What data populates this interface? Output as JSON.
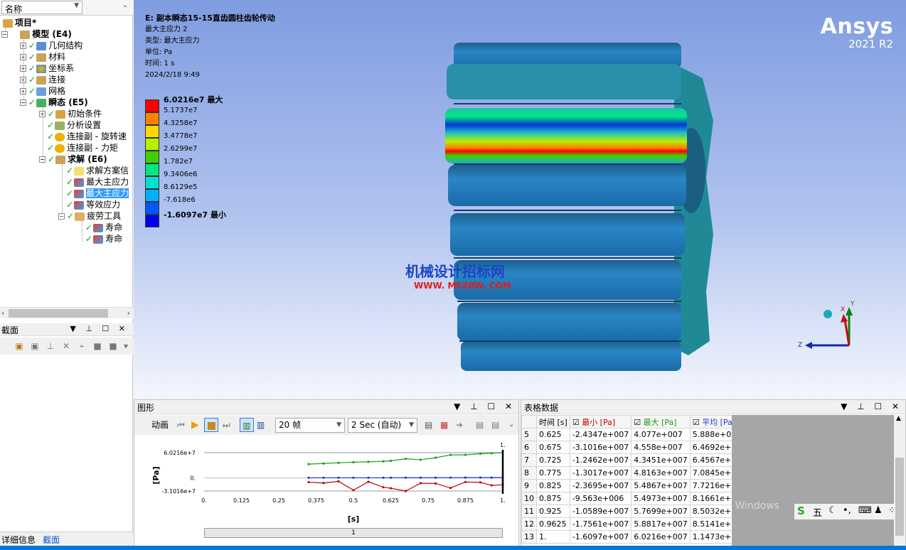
{
  "tree": {
    "header_select": "名称",
    "project": "项目*",
    "model": "模型 (E4)",
    "geometry": "几何结构",
    "materials": "材料",
    "coords": "坐标系",
    "connections": "连接",
    "mesh": "网格",
    "transient": "瞬态 (E5)",
    "initial": "初始条件",
    "analysis": "分析设置",
    "joint_rot": "连接副 - 旋转速",
    "joint_torque": "连接副 - 力矩",
    "solution": "求解 (E6)",
    "sol_info": "求解方案信",
    "max_p1": "最大主应力",
    "max_p2": "最大主应力",
    "eqv": "等效应力",
    "fatigue": "疲劳工具",
    "life1": "寿命",
    "life2": "寿命"
  },
  "section_panel": {
    "title": "截面"
  },
  "bottom_tabs": {
    "details": "详细信息",
    "section": "截面"
  },
  "viewport": {
    "title": "E: 副本瞬态15-15直齿圆柱齿轮传动",
    "result": "最大主应力 2",
    "type": "类型: 最大主应力",
    "unit": "单位: Pa",
    "time": "时间: 1 s",
    "date": "2024/2/18 9:49",
    "brand": "Ansys",
    "version": "2021 R2",
    "watermark_cn": "机械设计招标网",
    "watermark_url": "WWW. MEZBW. COM",
    "axis_x": "X",
    "axis_y": "Y",
    "axis_z": "Z"
  },
  "legend": {
    "labels": [
      "6.0216e7 最大",
      "5.1737e7",
      "4.3258e7",
      "3.4778e7",
      "2.6299e7",
      "1.782e7",
      "9.3406e6",
      "8.6129e5",
      "-7.618e6",
      "-1.6097e7 最小"
    ],
    "colors": [
      "#ff0000",
      "#ff7f00",
      "#ffd800",
      "#b6f000",
      "#3ed000",
      "#00e87e",
      "#00e2d0",
      "#00b0ff",
      "#0058ff",
      "#0000f0"
    ]
  },
  "graph_panel": {
    "title": "图形",
    "animate": "动画",
    "frames": "20 帧",
    "duration": "2 Sec (自动)",
    "time_slider_label": "1"
  },
  "chart_data": {
    "type": "line",
    "xlabel": "[s]",
    "ylabel": "[Pa]",
    "xlim": [
      0,
      1
    ],
    "ylim": [
      -31016000.0,
      60216000.0
    ],
    "x_ticks": [
      "0.",
      "0.125",
      "0.25",
      "0.375",
      "0.5",
      "0.625",
      "0.75",
      "0.875",
      "1."
    ],
    "y_ticks": [
      "6.0216e+7",
      "0.",
      "-3.1016e+7"
    ],
    "top_right_label": "1.",
    "x": [
      0.35,
      0.4,
      0.45,
      0.5,
      0.55,
      0.6,
      0.625,
      0.675,
      0.725,
      0.775,
      0.825,
      0.875,
      0.925,
      0.9625,
      1.0
    ],
    "series": [
      {
        "name": "最小 [Pa]",
        "color": "#c00000",
        "values": [
          -10000000.0,
          -12000000.0,
          -8000000.0,
          -29000000.0,
          -9000000.0,
          -22000000.0,
          -24347000.0,
          -31016000.0,
          -12462000.0,
          -13017000.0,
          -23695000.0,
          -9563000.0,
          -10589000.0,
          -17561000.0,
          -16097000.0
        ]
      },
      {
        "name": "最大 [Pa]",
        "color": "#1a9e1a",
        "values": [
          33000000.0,
          34500000.0,
          36000000.0,
          37500000.0,
          38500000.0,
          39500000.0,
          40770000.0,
          45580000.0,
          43451000.0,
          48163000.0,
          54867000.0,
          54973000.0,
          57699000.0,
          58817000.0,
          60216000.0
        ]
      },
      {
        "name": "平均 [Pa]",
        "color": "#1e3cc8",
        "values": [
          550000.0,
          560000.0,
          570000.0,
          575000.0,
          580000.0,
          585000.0,
          588800.0,
          646920.0,
          645670.0,
          708450.0,
          772160.0,
          816610.0,
          850320.0,
          851410.0,
          1147300.0
        ]
      }
    ]
  },
  "table_panel": {
    "title": "表格数据",
    "headers": [
      "时间 [s]",
      "最小 [Pa]",
      "最大 [Pa]",
      "平均 [Pa]"
    ],
    "rows": [
      [
        "5",
        "0.625",
        "-2.4347e+007",
        "4.077e+007",
        "5.888e+005"
      ],
      [
        "6",
        "0.675",
        "-3.1016e+007",
        "4.558e+007",
        "6.4692e+005"
      ],
      [
        "7",
        "0.725",
        "-1.2462e+007",
        "4.3451e+007",
        "6.4567e+005"
      ],
      [
        "8",
        "0.775",
        "-1.3017e+007",
        "4.8163e+007",
        "7.0845e+005"
      ],
      [
        "9",
        "0.825",
        "-2.3695e+007",
        "5.4867e+007",
        "7.7216e+005"
      ],
      [
        "10",
        "0.875",
        "-9.563e+006",
        "5.4973e+007",
        "8.1661e+005"
      ],
      [
        "11",
        "0.925",
        "-1.0589e+007",
        "5.7699e+007",
        "8.5032e+005"
      ],
      [
        "12",
        "0.9625",
        "-1.7561e+007",
        "5.8817e+007",
        "8.5141e+005"
      ],
      [
        "13",
        "1.",
        "-1.6097e+007",
        "6.0216e+007",
        "1.1473e+006"
      ]
    ],
    "win_watermark": "激活 Windows",
    "ime_label": "五"
  }
}
